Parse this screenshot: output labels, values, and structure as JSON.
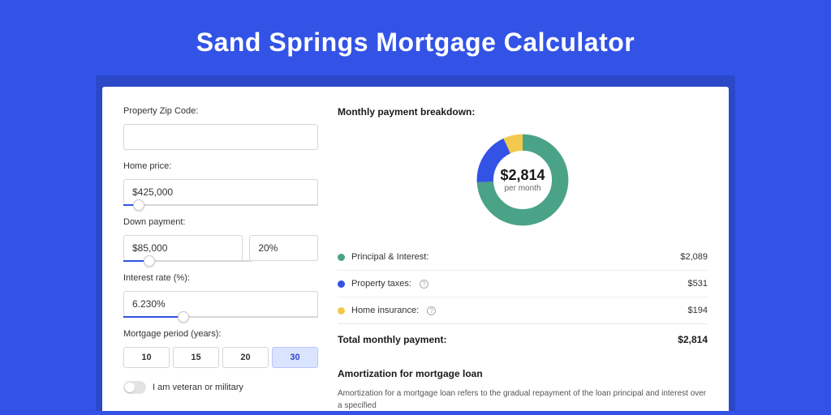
{
  "title": "Sand Springs Mortgage Calculator",
  "form": {
    "zip_label": "Property Zip Code:",
    "zip_value": "",
    "home_price_label": "Home price:",
    "home_price_value": "$425,000",
    "home_price_slider_pct": 8,
    "down_payment_label": "Down payment:",
    "down_payment_value": "$85,000",
    "down_payment_pct": "20%",
    "down_payment_slider_pct": 20,
    "interest_label": "Interest rate (%):",
    "interest_value": "6.230%",
    "interest_slider_pct": 31,
    "period_label": "Mortgage period (years):",
    "periods": [
      "10",
      "15",
      "20",
      "30"
    ],
    "period_selected": "30",
    "veteran_label": "I am veteran or military"
  },
  "breakdown": {
    "heading": "Monthly payment breakdown:",
    "donut_amount": "$2,814",
    "donut_sub": "per month",
    "items": [
      {
        "key": "principal",
        "label": "Principal & Interest:",
        "value": "$2,089",
        "color": "#4aa387",
        "pct": 74,
        "info": false
      },
      {
        "key": "taxes",
        "label": "Property taxes:",
        "value": "$531",
        "color": "#3353e6",
        "pct": 19,
        "info": true
      },
      {
        "key": "insurance",
        "label": "Home insurance:",
        "value": "$194",
        "color": "#f2c94c",
        "pct": 7,
        "info": true
      }
    ],
    "total_label": "Total monthly payment:",
    "total_value": "$2,814"
  },
  "amortization": {
    "heading": "Amortization for mortgage loan",
    "text": "Amortization for a mortgage loan refers to the gradual repayment of the loan principal and interest over a specified"
  },
  "chart_data": {
    "type": "pie",
    "title": "Monthly payment breakdown",
    "categories": [
      "Principal & Interest",
      "Property taxes",
      "Home insurance"
    ],
    "values": [
      2089,
      531,
      194
    ],
    "colors": [
      "#4aa387",
      "#3353e6",
      "#f2c94c"
    ],
    "total": 2814,
    "unit": "USD per month"
  }
}
